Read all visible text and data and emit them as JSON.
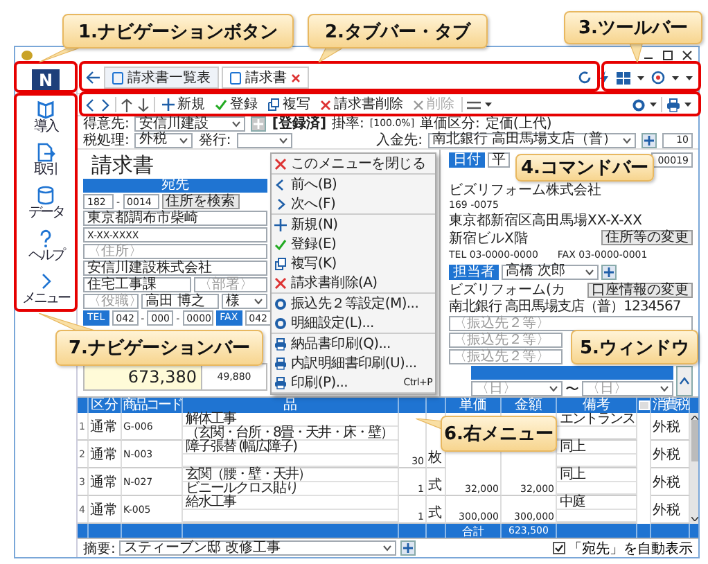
{
  "callouts": [
    {
      "label": "1.ナビゲーションボタン"
    },
    {
      "label": "2.タブバー・タブ"
    },
    {
      "label": "3.ツールバー"
    },
    {
      "label": "4.コマンドバー"
    },
    {
      "label": "5.ウィンドウ"
    },
    {
      "label": "6.右メニュー"
    },
    {
      "label": "7.ナビゲーションバー"
    }
  ],
  "nav_button": {
    "label": "N"
  },
  "nav_items": [
    {
      "label": "導入"
    },
    {
      "label": "取引"
    },
    {
      "label": "データ"
    },
    {
      "label": "ヘルプ"
    },
    {
      "label": "メニュー"
    }
  ],
  "tabs": [
    {
      "label": "請求書一覧表",
      "selected": false,
      "closable": false
    },
    {
      "label": "請求書",
      "selected": true,
      "closable": true
    }
  ],
  "commands": [
    {
      "label": "新規",
      "disabled": false
    },
    {
      "label": "登録",
      "disabled": false
    },
    {
      "label": "複写",
      "disabled": false
    },
    {
      "label": "請求書削除",
      "disabled": false
    },
    {
      "label": "削除",
      "disabled": true
    }
  ],
  "form": {
    "customer_label": "得意先:",
    "customer": "安信川建設",
    "status": "[登録済]",
    "rate_label": "掛率:",
    "rate": "[100.0%]",
    "price_class_label": "単価区分:",
    "price_class": "定価(上代)",
    "tax_label": "税処理:",
    "tax": "外税",
    "issue_label": "発行:",
    "deposit_label": "入金先:",
    "deposit": "南北銀行 高田馬場支店（普）",
    "right_field": "10"
  },
  "document": {
    "title": "請求書",
    "addressee_header": "宛先",
    "postal_1": "182",
    "postal_sep": "-",
    "postal_2": "0014",
    "address_search": "住所を検索",
    "address_1": "東京都調布市柴崎",
    "address_2": "X-XX-XXXX",
    "address_3_placeholder": "〈住所〉",
    "company": "安信川建設株式会社",
    "department": "住宅工事課",
    "department_2_placeholder": "〈部署〉",
    "position_placeholder": "〈役職〉",
    "person": "高田 博之",
    "honorific": "様",
    "tel_label": "TEL",
    "tel": [
      "042",
      "000",
      "0000"
    ],
    "tel_sep": "-",
    "fax_label": "FAX",
    "fax": "042",
    "amount": "673,380",
    "amount_2": "49,880"
  },
  "sender": {
    "date_label": "日付",
    "date": "平",
    "number": "00019",
    "company": "ビズリフォーム株式会社",
    "postal": "169 -0075",
    "address": "東京都新宿区高田馬場XX-X-XX",
    "building": "新宿ビルX階",
    "tel": "TEL 03-0000-0000",
    "fax": "FAX 03-0000-0001",
    "change_address": "住所等の変更",
    "staff_label": "担当者",
    "staff": "高橋 次郎",
    "account_name": "ビズリフォーム(カ",
    "change_account": "口座情報の変更",
    "bank": "南北銀行 高田馬場支店（普）1234567",
    "transfer_placeholders": [
      "〈振込先２等〉",
      "〈振込先２等〉",
      "〈振込先２等〉"
    ],
    "period_from": "〈日〉",
    "period_sep": "〜",
    "period_to": "〈日〉"
  },
  "context_menu": {
    "groups": [
      [
        {
          "label": "このメニューを閉じる"
        }
      ],
      [
        {
          "label": "前へ(B)"
        },
        {
          "label": "次へ(F)"
        }
      ],
      [
        {
          "label": "新規(N)"
        },
        {
          "label": "登録(E)"
        },
        {
          "label": "複写(K)"
        },
        {
          "label": "請求書削除(A)"
        }
      ],
      [
        {
          "label": "振込先２等設定(M)..."
        },
        {
          "label": "明細設定(L)..."
        }
      ],
      [
        {
          "label": "納品書印刷(Q)..."
        },
        {
          "label": "内訳明細書印刷(U)..."
        },
        {
          "label": "印刷(P)...",
          "shortcut": "Ctrl+P"
        }
      ]
    ]
  },
  "table": {
    "columns": [
      "区分",
      "商品コード",
      "品",
      "単価",
      "金額",
      "備考",
      "消費税"
    ],
    "rows": [
      {
        "no": "1",
        "category": "通常",
        "code": "G-006",
        "name": [
          "解体工事",
          "（玄関・台所・8畳・天井・床・壁）"
        ],
        "note": "エントランス",
        "tax": "外税"
      },
      {
        "no": "2",
        "category": "通常",
        "code": "N-003",
        "name": [
          "障子張替 (幅広障子)"
        ],
        "qty": "30",
        "unit": "枚",
        "note": "同上",
        "tax": "外税"
      },
      {
        "no": "3",
        "category": "通常",
        "code": "N-027",
        "name": [
          "玄関（腰・壁・天井）",
          "ビニールクロス貼り"
        ],
        "qty": "1",
        "unit": "式",
        "price": "32,000",
        "amount": "32,000",
        "note": "同上",
        "tax": "外税"
      },
      {
        "no": "4",
        "category": "通常",
        "code": "K-005",
        "name": [
          "給水工事"
        ],
        "qty": "1",
        "unit": "式",
        "price": "300,000",
        "amount": "300,000",
        "note": "中庭",
        "tax": "外税"
      }
    ],
    "total_label": "合計",
    "total": "623,500"
  },
  "footer": {
    "summary_label": "摘要:",
    "summary": "スティーブン邸 改修工事",
    "auto_checkbox": {
      "label": "「宛先」を自動表示",
      "checked": true
    }
  }
}
